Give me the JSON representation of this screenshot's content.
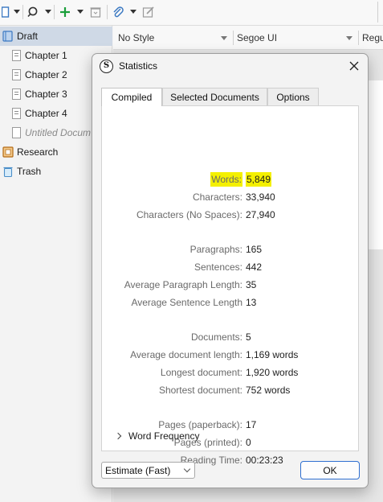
{
  "toolbar": {
    "icons": [
      "document-icon",
      "search-icon",
      "add-icon",
      "trash-icon",
      "attachment-icon",
      "edit-icon"
    ],
    "accent_add": "#1a9e3a",
    "accent_doc": "#3a78c2"
  },
  "binder": {
    "items": [
      {
        "label": "Draft",
        "icon": "draft-folder-icon"
      },
      {
        "label": "Chapter 1",
        "icon": "text-document-icon"
      },
      {
        "label": "Chapter 2",
        "icon": "text-document-icon"
      },
      {
        "label": "Chapter 3",
        "icon": "text-document-icon"
      },
      {
        "label": "Chapter 4",
        "icon": "text-document-icon"
      },
      {
        "label": "Untitled Docum",
        "icon": "empty-document-icon"
      },
      {
        "label": "Research",
        "icon": "research-folder-icon"
      },
      {
        "label": "Trash",
        "icon": "trash-icon"
      }
    ],
    "selected_bg": "#cfd9e6"
  },
  "formatbar": {
    "style": "No Style",
    "font": "Segoe UI",
    "weight": "Regu"
  },
  "dialog": {
    "title": "Statistics",
    "app_icon_letter": "S",
    "tabs": [
      "Compiled",
      "Selected Documents",
      "Options"
    ],
    "stats": {
      "words_label": "Words:",
      "words_value": "5,849",
      "characters_label": "Characters:",
      "characters_value": "33,940",
      "characters_ns_label": "Characters (No Spaces):",
      "characters_ns_value": "27,940",
      "paragraphs_label": "Paragraphs:",
      "paragraphs_value": "165",
      "sentences_label": "Sentences:",
      "sentences_value": "442",
      "avg_paragraph_label": "Average Paragraph Length:",
      "avg_paragraph_value": "35",
      "avg_sentence_label": "Average Sentence Length",
      "avg_sentence_value": "13",
      "documents_label": "Documents:",
      "documents_value": "5",
      "avg_doc_label": "Average document length:",
      "avg_doc_value": "1,169 words",
      "longest_label": "Longest document:",
      "longest_value": "1,920 words",
      "shortest_label": "Shortest document:",
      "shortest_value": "752 words",
      "pages_pb_label": "Pages (paperback):",
      "pages_pb_value": "17",
      "pages_pr_label": "Pages (printed):",
      "pages_pr_value": "0",
      "reading_label": "Reading Time:",
      "reading_value": "00:23:23"
    },
    "word_frequency": "Word Frequency",
    "estimate_select": "Estimate (Fast)",
    "ok_label": "OK",
    "highlight_color": "#f4f000",
    "ok_border_color": "#2f6fd0"
  }
}
